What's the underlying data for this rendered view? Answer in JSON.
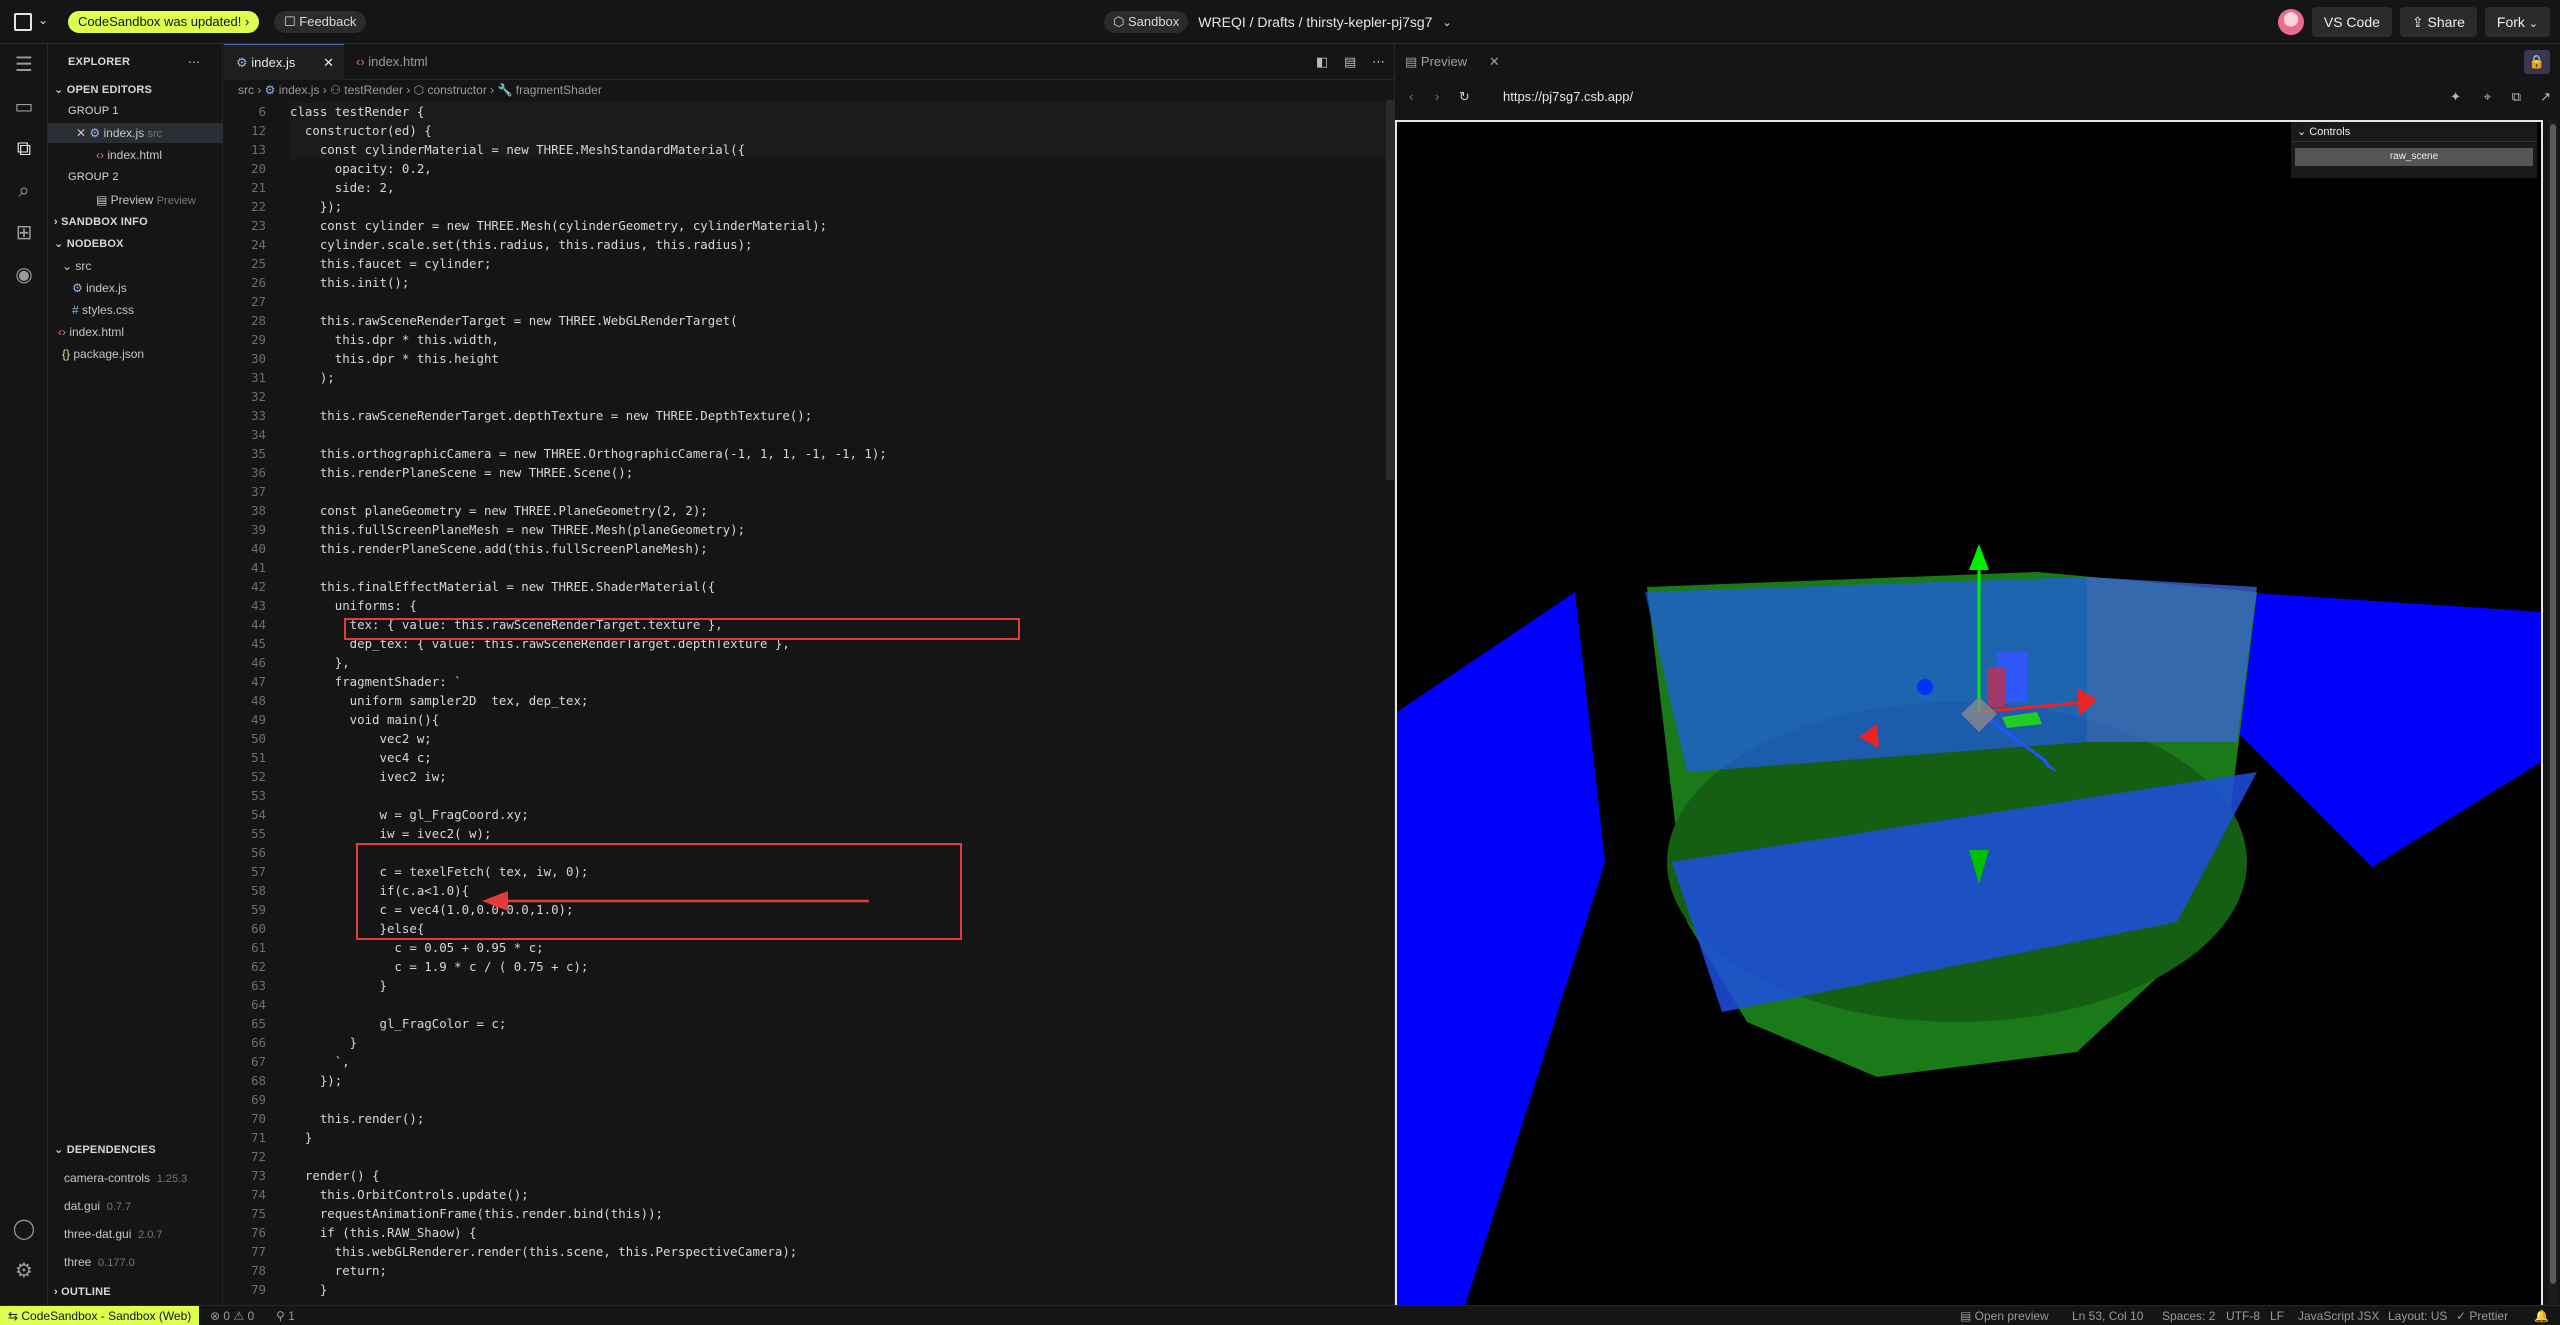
{
  "topbar": {
    "update_pill": "CodeSandbox was updated!",
    "update_chevron": "›",
    "feedback": "Feedback",
    "sandbox_pill": "Sandbox",
    "path": "WREQI / Drafts / thirsty-kepler-pj7sg7",
    "vscode": "VS Code",
    "share": "Share",
    "fork": "Fork"
  },
  "sidebar": {
    "title": "EXPLORER",
    "open_editors": "OPEN EDITORS",
    "group1": "GROUP 1",
    "oe_index_js": "index.js",
    "oe_index_js_dir": "src",
    "oe_index_html": "index.html",
    "group2": "GROUP 2",
    "oe_preview": "Preview",
    "oe_preview_hint": "Preview",
    "sandbox_info": "SANDBOX INFO",
    "nodebox": "NODEBOX",
    "src": "src",
    "f_index_js": "index.js",
    "f_styles": "styles.css",
    "f_index_html": "index.html",
    "f_package": "package.json",
    "dependencies": "DEPENDENCIES",
    "deps": [
      {
        "name": "camera-controls",
        "ver": "1.25.3"
      },
      {
        "name": "dat.gui",
        "ver": "0.7.7"
      },
      {
        "name": "three-dat.gui",
        "ver": "2.0.7"
      },
      {
        "name": "three",
        "ver": "0.177.0"
      }
    ],
    "outline": "OUTLINE"
  },
  "editor": {
    "tab1": "index.js",
    "tab2": "index.html",
    "breadcrumb": [
      "src",
      "index.js",
      "testRender",
      "constructor",
      "fragmentShader"
    ],
    "lines": [
      {
        "n": "6",
        "t": "class testRender {"
      },
      {
        "n": "12",
        "t": "  constructor(ed) {"
      },
      {
        "n": "13",
        "t": "    const cylinderMaterial = new THREE.MeshStandardMaterial({"
      },
      {
        "n": "20",
        "t": "      opacity: 0.2,"
      },
      {
        "n": "21",
        "t": "      side: 2,"
      },
      {
        "n": "22",
        "t": "    });"
      },
      {
        "n": "23",
        "t": "    const cylinder = new THREE.Mesh(cylinderGeometry, cylinderMaterial);"
      },
      {
        "n": "24",
        "t": "    cylinder.scale.set(this.radius, this.radius, this.radius);"
      },
      {
        "n": "25",
        "t": "    this.faucet = cylinder;"
      },
      {
        "n": "26",
        "t": "    this.init();"
      },
      {
        "n": "27",
        "t": ""
      },
      {
        "n": "28",
        "t": "    this.rawSceneRenderTarget = new THREE.WebGLRenderTarget("
      },
      {
        "n": "29",
        "t": "      this.dpr * this.width,"
      },
      {
        "n": "30",
        "t": "      this.dpr * this.height"
      },
      {
        "n": "31",
        "t": "    );"
      },
      {
        "n": "32",
        "t": ""
      },
      {
        "n": "33",
        "t": "    this.rawSceneRenderTarget.depthTexture = new THREE.DepthTexture();"
      },
      {
        "n": "34",
        "t": ""
      },
      {
        "n": "35",
        "t": "    this.orthographicCamera = new THREE.OrthographicCamera(-1, 1, 1, -1, -1, 1);"
      },
      {
        "n": "36",
        "t": "    this.renderPlaneScene = new THREE.Scene();"
      },
      {
        "n": "37",
        "t": ""
      },
      {
        "n": "38",
        "t": "    const planeGeometry = new THREE.PlaneGeometry(2, 2);"
      },
      {
        "n": "39",
        "t": "    this.fullScreenPlaneMesh = new THREE.Mesh(planeGeometry);"
      },
      {
        "n": "40",
        "t": "    this.renderPlaneScene.add(this.fullScreenPlaneMesh);"
      },
      {
        "n": "41",
        "t": ""
      },
      {
        "n": "42",
        "t": "    this.finalEffectMaterial = new THREE.ShaderMaterial({"
      },
      {
        "n": "43",
        "t": "      uniforms: {"
      },
      {
        "n": "44",
        "t": "        tex: { value: this.rawSceneRenderTarget.texture },"
      },
      {
        "n": "45",
        "t": "        dep_tex: { value: this.rawSceneRenderTarget.depthTexture },"
      },
      {
        "n": "46",
        "t": "      },"
      },
      {
        "n": "47",
        "t": "      fragmentShader: `"
      },
      {
        "n": "48",
        "t": "        uniform sampler2D  tex, dep_tex;"
      },
      {
        "n": "49",
        "t": "        void main(){"
      },
      {
        "n": "50",
        "t": "            vec2 w;"
      },
      {
        "n": "51",
        "t": "            vec4 c;"
      },
      {
        "n": "52",
        "t": "            ivec2 iw;"
      },
      {
        "n": "53",
        "t": ""
      },
      {
        "n": "54",
        "t": "            w = gl_FragCoord.xy;"
      },
      {
        "n": "55",
        "t": "            iw = ivec2( w);"
      },
      {
        "n": "56",
        "t": ""
      },
      {
        "n": "57",
        "t": "            c = texelFetch( tex, iw, 0);"
      },
      {
        "n": "58",
        "t": "            if(c.a<1.0){"
      },
      {
        "n": "59",
        "t": "            c = vec4(1.0,0.0,0.0,1.0);"
      },
      {
        "n": "60",
        "t": "            }else{"
      },
      {
        "n": "61",
        "t": "              c = 0.05 + 0.95 * c;"
      },
      {
        "n": "62",
        "t": "              c = 1.9 * c / ( 0.75 + c);"
      },
      {
        "n": "63",
        "t": "            }"
      },
      {
        "n": "64",
        "t": ""
      },
      {
        "n": "65",
        "t": "            gl_FragColor = c;"
      },
      {
        "n": "66",
        "t": "        }"
      },
      {
        "n": "67",
        "t": "      `,"
      },
      {
        "n": "68",
        "t": "    });"
      },
      {
        "n": "69",
        "t": ""
      },
      {
        "n": "70",
        "t": "    this.render();"
      },
      {
        "n": "71",
        "t": "  }"
      },
      {
        "n": "72",
        "t": ""
      },
      {
        "n": "73",
        "t": "  render() {"
      },
      {
        "n": "74",
        "t": "    this.OrbitControls.update();"
      },
      {
        "n": "75",
        "t": "    requestAnimationFrame(this.render.bind(this));"
      },
      {
        "n": "76",
        "t": "    if (this.RAW_Shaow) {"
      },
      {
        "n": "77",
        "t": "      this.webGLRenderer.render(this.scene, this.PerspectiveCamera);"
      },
      {
        "n": "78",
        "t": "      return;"
      },
      {
        "n": "79",
        "t": "    }"
      }
    ]
  },
  "preview": {
    "tab": "Preview",
    "url": "https://pj7sg7.csb.app/",
    "gui_title": "Controls",
    "gui_item": "raw_scene"
  },
  "statusbar": {
    "brand": "CodeSandbox - Sandbox (Web)",
    "problems": "⊗ 0 ⚠ 0",
    "ports": "⚲ 1",
    "open_preview": "Open preview",
    "position": "Ln 53, Col 10",
    "spaces": "Spaces: 2",
    "encoding": "UTF-8",
    "eol": "LF",
    "language": "JavaScript JSX",
    "layout": "Layout: US",
    "prettier": "✓ Prettier"
  },
  "colors": {
    "accent": "#dcff50",
    "annotation": "#e23b3b",
    "plane_blue": "#0000ff",
    "cylinder_green": "#1a7a1a"
  }
}
